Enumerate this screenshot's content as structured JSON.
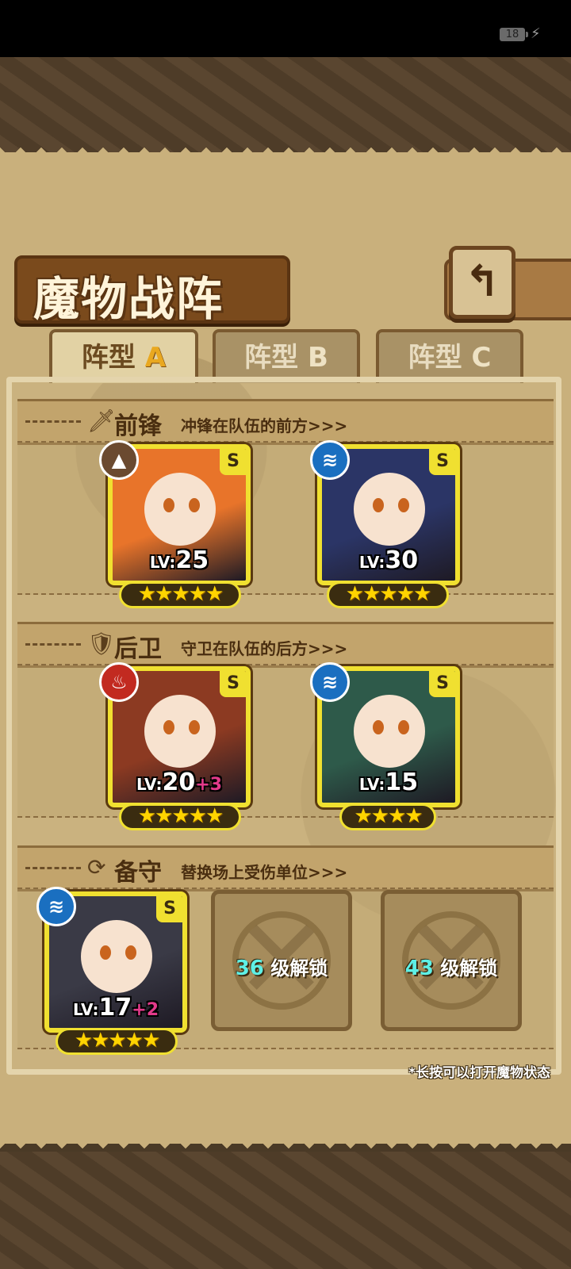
{
  "status_bar": {
    "battery": "18",
    "charging_icon": "bolt-icon"
  },
  "header": {
    "title": "魔物战阵",
    "back_icon": "return-arrow-icon",
    "back_glyph": "↰"
  },
  "tabs": [
    {
      "prefix": "阵型",
      "letter": "A",
      "active": true
    },
    {
      "prefix": "阵型",
      "letter": "B",
      "active": false
    },
    {
      "prefix": "阵型",
      "letter": "C",
      "active": false
    }
  ],
  "sections": {
    "vanguard": {
      "icon": "sword-icon",
      "name": "前锋",
      "desc": "冲锋在队伍的前方>>>"
    },
    "rear": {
      "icon": "shield-icon",
      "name": "后卫",
      "desc": "守卫在队伍的后方>>>"
    },
    "reserve": {
      "icon": "swap-icon",
      "name": "备守",
      "desc": "替换场上受伤单位>>>"
    }
  },
  "units": [
    {
      "slot": "vanguard-1",
      "element": "earth",
      "element_color": "#6b4a30",
      "grade": "S",
      "lv_label": "LV:",
      "level": "25",
      "bonus": "",
      "stars": "★★★★★",
      "theme": "#e8742a"
    },
    {
      "slot": "vanguard-2",
      "element": "water",
      "element_color": "#1a6fc0",
      "grade": "S",
      "lv_label": "LV:",
      "level": "30",
      "bonus": "",
      "stars": "★★★★★",
      "theme": "#2b3566"
    },
    {
      "slot": "rear-1",
      "element": "fire",
      "element_color": "#c22a20",
      "grade": "S",
      "lv_label": "LV:",
      "level": "20",
      "bonus": "+3",
      "stars": "★★★★★",
      "theme": "#8c3a22"
    },
    {
      "slot": "rear-2",
      "element": "water",
      "element_color": "#1a6fc0",
      "grade": "S",
      "lv_label": "LV:",
      "level": "15",
      "bonus": "",
      "stars": "★★★★",
      "theme": "#2e5a4a"
    },
    {
      "slot": "reserve-1",
      "element": "water",
      "element_color": "#1a6fc0",
      "grade": "S",
      "lv_label": "LV:",
      "level": "17",
      "bonus": "+2",
      "stars": "★★★★★",
      "theme": "#3a3a46"
    }
  ],
  "locked_slots": [
    {
      "level": "36",
      "text": "级解锁"
    },
    {
      "level": "43",
      "text": "级解锁"
    }
  ],
  "hint": "*长按可以打开魔物状态"
}
